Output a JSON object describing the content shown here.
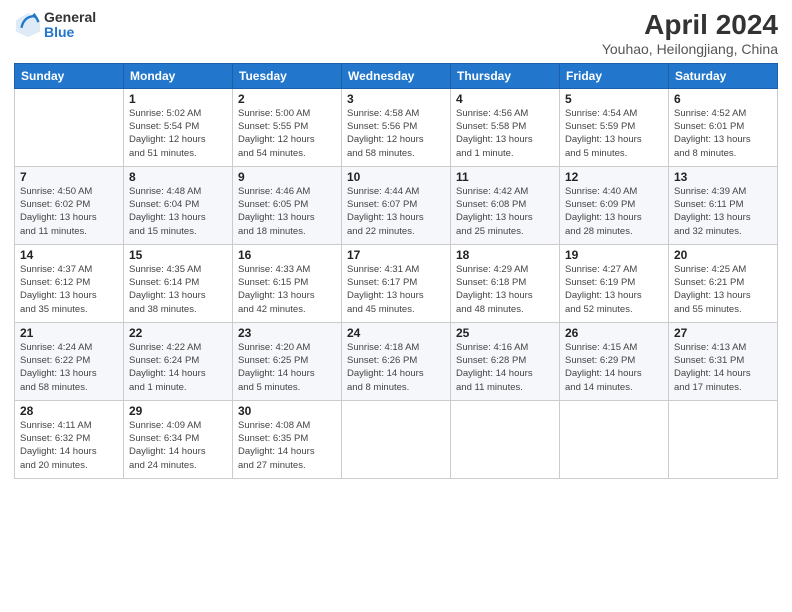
{
  "logo": {
    "general": "General",
    "blue": "Blue"
  },
  "header": {
    "title": "April 2024",
    "subtitle": "Youhao, Heilongjiang, China"
  },
  "days_of_week": [
    "Sunday",
    "Monday",
    "Tuesday",
    "Wednesday",
    "Thursday",
    "Friday",
    "Saturday"
  ],
  "weeks": [
    [
      {
        "day": "",
        "info": ""
      },
      {
        "day": "1",
        "info": "Sunrise: 5:02 AM\nSunset: 5:54 PM\nDaylight: 12 hours\nand 51 minutes."
      },
      {
        "day": "2",
        "info": "Sunrise: 5:00 AM\nSunset: 5:55 PM\nDaylight: 12 hours\nand 54 minutes."
      },
      {
        "day": "3",
        "info": "Sunrise: 4:58 AM\nSunset: 5:56 PM\nDaylight: 12 hours\nand 58 minutes."
      },
      {
        "day": "4",
        "info": "Sunrise: 4:56 AM\nSunset: 5:58 PM\nDaylight: 13 hours\nand 1 minute."
      },
      {
        "day": "5",
        "info": "Sunrise: 4:54 AM\nSunset: 5:59 PM\nDaylight: 13 hours\nand 5 minutes."
      },
      {
        "day": "6",
        "info": "Sunrise: 4:52 AM\nSunset: 6:01 PM\nDaylight: 13 hours\nand 8 minutes."
      }
    ],
    [
      {
        "day": "7",
        "info": "Sunrise: 4:50 AM\nSunset: 6:02 PM\nDaylight: 13 hours\nand 11 minutes."
      },
      {
        "day": "8",
        "info": "Sunrise: 4:48 AM\nSunset: 6:04 PM\nDaylight: 13 hours\nand 15 minutes."
      },
      {
        "day": "9",
        "info": "Sunrise: 4:46 AM\nSunset: 6:05 PM\nDaylight: 13 hours\nand 18 minutes."
      },
      {
        "day": "10",
        "info": "Sunrise: 4:44 AM\nSunset: 6:07 PM\nDaylight: 13 hours\nand 22 minutes."
      },
      {
        "day": "11",
        "info": "Sunrise: 4:42 AM\nSunset: 6:08 PM\nDaylight: 13 hours\nand 25 minutes."
      },
      {
        "day": "12",
        "info": "Sunrise: 4:40 AM\nSunset: 6:09 PM\nDaylight: 13 hours\nand 28 minutes."
      },
      {
        "day": "13",
        "info": "Sunrise: 4:39 AM\nSunset: 6:11 PM\nDaylight: 13 hours\nand 32 minutes."
      }
    ],
    [
      {
        "day": "14",
        "info": "Sunrise: 4:37 AM\nSunset: 6:12 PM\nDaylight: 13 hours\nand 35 minutes."
      },
      {
        "day": "15",
        "info": "Sunrise: 4:35 AM\nSunset: 6:14 PM\nDaylight: 13 hours\nand 38 minutes."
      },
      {
        "day": "16",
        "info": "Sunrise: 4:33 AM\nSunset: 6:15 PM\nDaylight: 13 hours\nand 42 minutes."
      },
      {
        "day": "17",
        "info": "Sunrise: 4:31 AM\nSunset: 6:17 PM\nDaylight: 13 hours\nand 45 minutes."
      },
      {
        "day": "18",
        "info": "Sunrise: 4:29 AM\nSunset: 6:18 PM\nDaylight: 13 hours\nand 48 minutes."
      },
      {
        "day": "19",
        "info": "Sunrise: 4:27 AM\nSunset: 6:19 PM\nDaylight: 13 hours\nand 52 minutes."
      },
      {
        "day": "20",
        "info": "Sunrise: 4:25 AM\nSunset: 6:21 PM\nDaylight: 13 hours\nand 55 minutes."
      }
    ],
    [
      {
        "day": "21",
        "info": "Sunrise: 4:24 AM\nSunset: 6:22 PM\nDaylight: 13 hours\nand 58 minutes."
      },
      {
        "day": "22",
        "info": "Sunrise: 4:22 AM\nSunset: 6:24 PM\nDaylight: 14 hours\nand 1 minute."
      },
      {
        "day": "23",
        "info": "Sunrise: 4:20 AM\nSunset: 6:25 PM\nDaylight: 14 hours\nand 5 minutes."
      },
      {
        "day": "24",
        "info": "Sunrise: 4:18 AM\nSunset: 6:26 PM\nDaylight: 14 hours\nand 8 minutes."
      },
      {
        "day": "25",
        "info": "Sunrise: 4:16 AM\nSunset: 6:28 PM\nDaylight: 14 hours\nand 11 minutes."
      },
      {
        "day": "26",
        "info": "Sunrise: 4:15 AM\nSunset: 6:29 PM\nDaylight: 14 hours\nand 14 minutes."
      },
      {
        "day": "27",
        "info": "Sunrise: 4:13 AM\nSunset: 6:31 PM\nDaylight: 14 hours\nand 17 minutes."
      }
    ],
    [
      {
        "day": "28",
        "info": "Sunrise: 4:11 AM\nSunset: 6:32 PM\nDaylight: 14 hours\nand 20 minutes."
      },
      {
        "day": "29",
        "info": "Sunrise: 4:09 AM\nSunset: 6:34 PM\nDaylight: 14 hours\nand 24 minutes."
      },
      {
        "day": "30",
        "info": "Sunrise: 4:08 AM\nSunset: 6:35 PM\nDaylight: 14 hours\nand 27 minutes."
      },
      {
        "day": "",
        "info": ""
      },
      {
        "day": "",
        "info": ""
      },
      {
        "day": "",
        "info": ""
      },
      {
        "day": "",
        "info": ""
      }
    ]
  ]
}
